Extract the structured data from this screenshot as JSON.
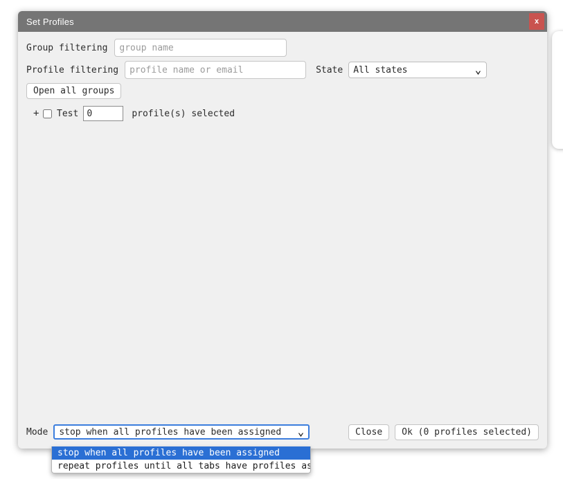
{
  "window": {
    "title": "Set Profiles",
    "close_icon": "close-icon",
    "close_label": "x"
  },
  "filters": {
    "group_label": "Group filtering",
    "group_placeholder": "group name",
    "group_value": "",
    "profile_label": "Profile filtering",
    "profile_placeholder": "profile name or email",
    "profile_value": "",
    "state_label": "State",
    "state_value": "All states",
    "state_options": [
      "All states"
    ],
    "caret_icon": "chevron-down-icon"
  },
  "actions": {
    "open_all_groups": "Open all groups"
  },
  "groups": [
    {
      "expander": "+",
      "name": "Test",
      "count": "0",
      "suffix": "profile(s) selected",
      "checked": false
    }
  ],
  "footer": {
    "mode_label": "Mode",
    "mode_value": "stop when all profiles have been assigned",
    "mode_options": [
      "stop when all profiles have been assigned",
      "repeat profiles until all tabs have profiles assigned"
    ],
    "close_button": "Close",
    "ok_button": "Ok (0 profiles selected)"
  },
  "colors": {
    "titlebar": "#757575",
    "close_button": "#c9534f",
    "dialog_body": "#f0f0f0",
    "focus_border": "#3b7ddd",
    "dropdown_highlight": "#2a6fd4"
  }
}
